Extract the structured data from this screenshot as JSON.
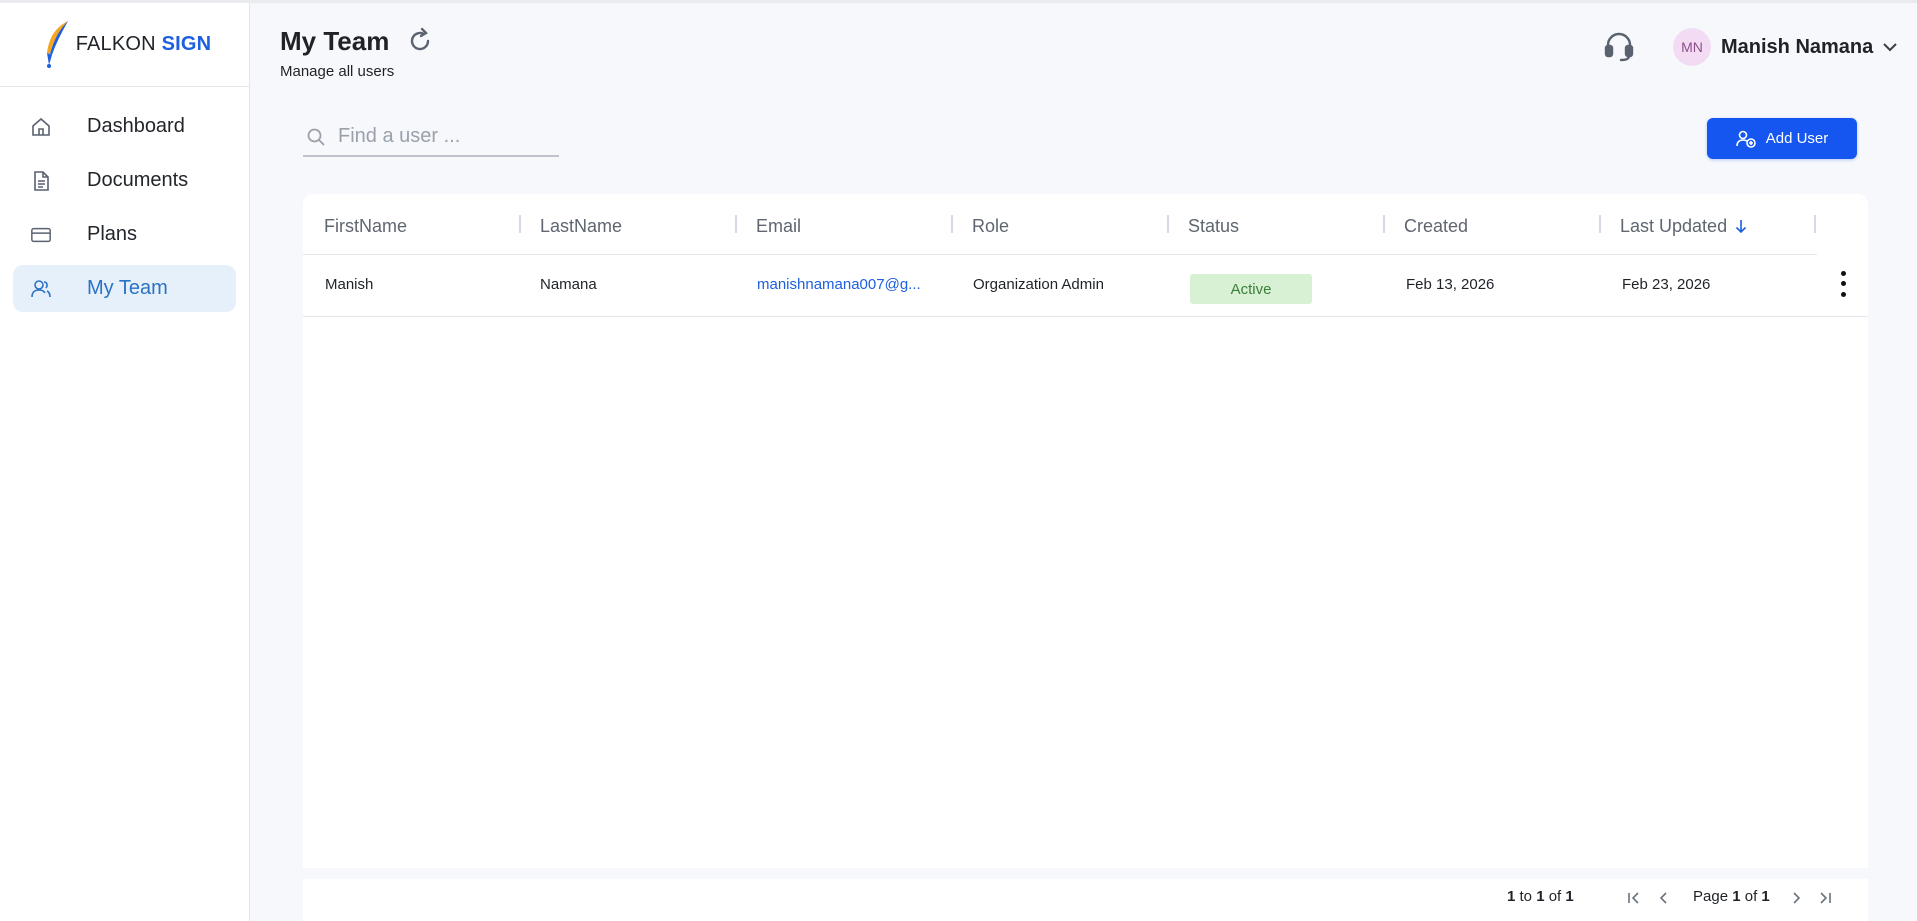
{
  "brand": {
    "name_plain": "FALKON",
    "name_accent": "SIGN",
    "accent_color": "#1d5fe0"
  },
  "sidebar": {
    "items": [
      {
        "label": "Dashboard",
        "icon": "home-icon",
        "active": false
      },
      {
        "label": "Documents",
        "icon": "document-icon",
        "active": false
      },
      {
        "label": "Plans",
        "icon": "credit-card-icon",
        "active": false
      },
      {
        "label": "My Team",
        "icon": "team-icon",
        "active": true
      }
    ]
  },
  "header": {
    "title": "My Team",
    "subtitle": "Manage all users",
    "user_initials": "MN",
    "user_name": "Manish Namana"
  },
  "search": {
    "placeholder": "Find a user ...",
    "value": ""
  },
  "actions": {
    "add_user_label": "Add User",
    "primary_color": "#1556f0"
  },
  "table": {
    "columns": [
      "FirstName",
      "LastName",
      "Email",
      "Role",
      "Status",
      "Created",
      "Last Updated"
    ],
    "sorted_column": "Last Updated",
    "sort_direction": "descending",
    "rows": [
      {
        "first_name": "Manish",
        "last_name": "Namana",
        "email": "manishnamana007@g...",
        "role": "Organization Admin",
        "status": "Active",
        "created": "Feb 13, 2026",
        "last_updated": "Feb 23, 2026"
      }
    ]
  },
  "pagination": {
    "range_from": "1",
    "range_to_word": "to",
    "range_to": "1",
    "of_word": "of",
    "total": "1",
    "page_word": "Page",
    "page": "1",
    "page_of_word": "of",
    "page_total": "1"
  }
}
